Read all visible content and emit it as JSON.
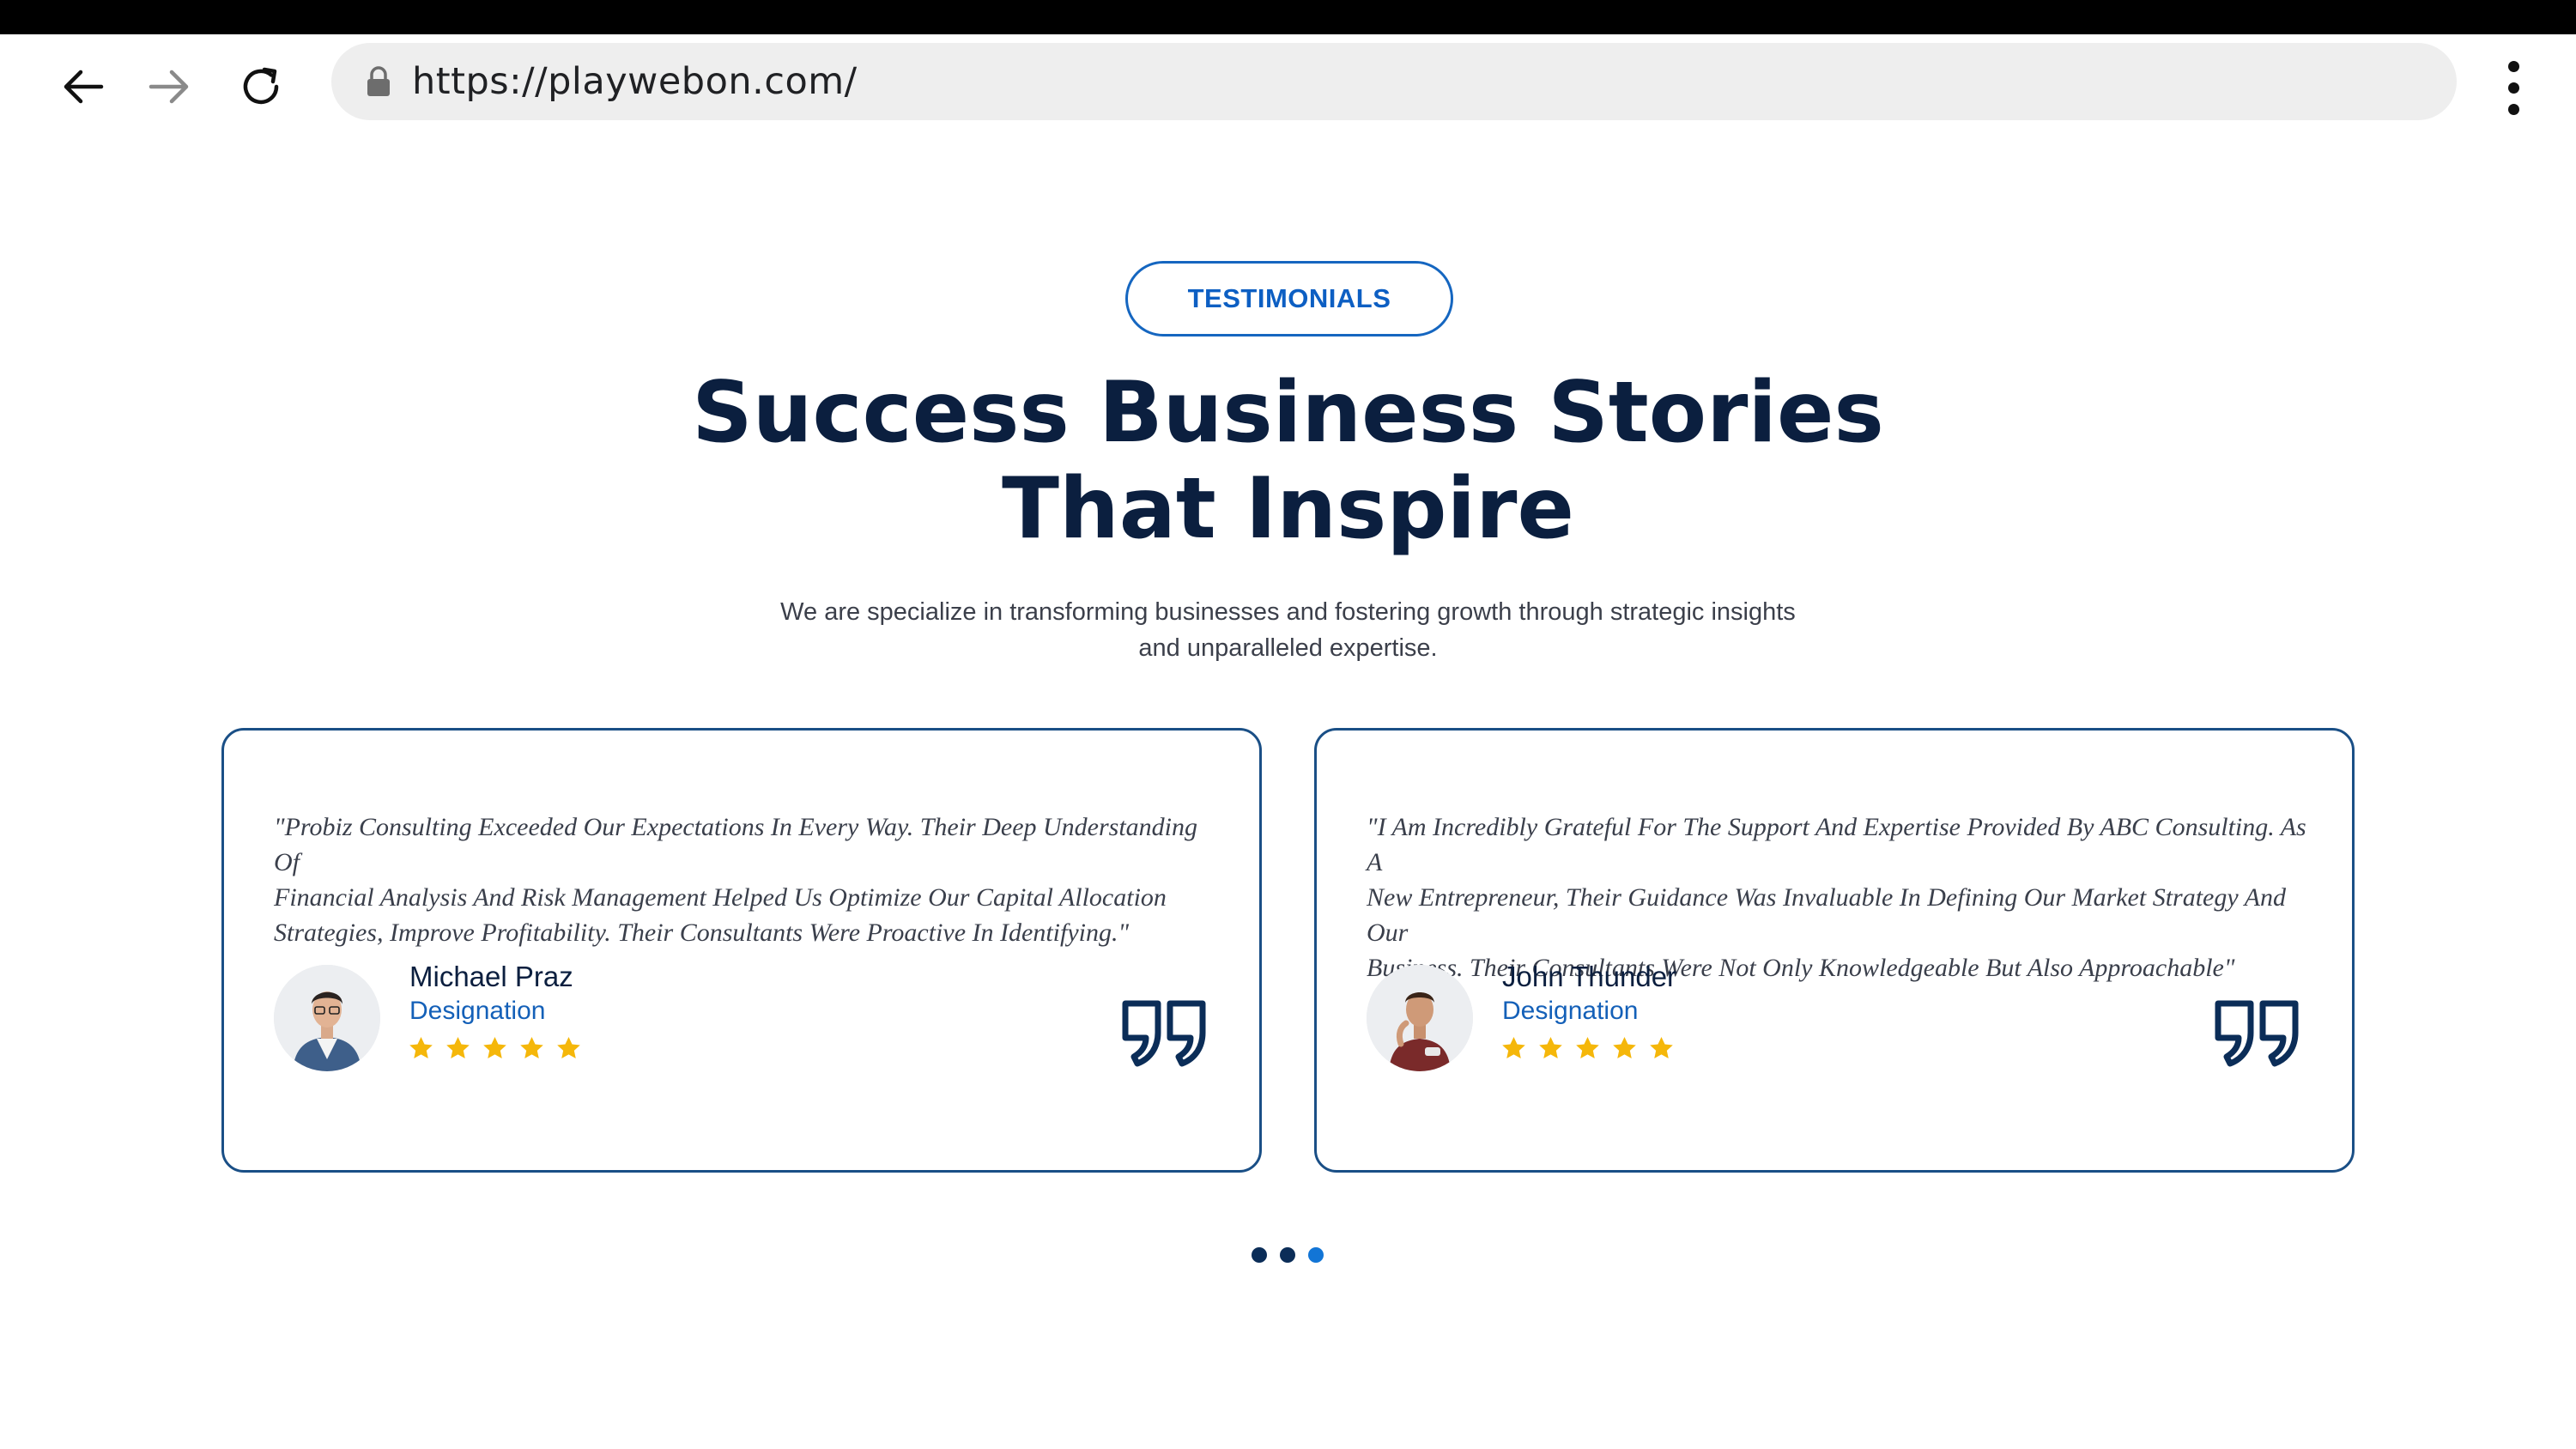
{
  "browser": {
    "url": "https://playwebon.com/",
    "icons": [
      "back-arrow-icon",
      "forward-arrow-icon",
      "reload-icon",
      "lock-icon",
      "more-vert-icon"
    ]
  },
  "section": {
    "badge": "TESTIMONIALS",
    "title_line1": "Success Business Stories",
    "title_line2": "That Inspire",
    "subtitle_line1": "We are specialize in transforming businesses and fostering growth through strategic insights",
    "subtitle_line2": "and unparalleled expertise."
  },
  "testimonials": [
    {
      "quote_line1": "\"Probiz Consulting Exceeded Our Expectations In Every Way. Their Deep Understanding Of",
      "quote_line2": "Financial Analysis And Risk Management Helped Us Optimize Our Capital Allocation",
      "quote_line3": "Strategies, Improve Profitability. Their Consultants Were Proactive In Identifying.\"",
      "name": "Michael Praz",
      "designation": "Designation",
      "rating": 5
    },
    {
      "quote_line1": "\"I Am Incredibly Grateful For The Support And Expertise Provided By ABC Consulting. As A",
      "quote_line2": "New Entrepreneur, Their Guidance Was Invaluable In Defining Our Market Strategy And Our",
      "quote_line3": "Business. Their Consultants Were Not Only Knowledgeable But Also Approachable\"",
      "name": "John Thunder",
      "designation": "Designation",
      "rating": 5
    }
  ],
  "carousel": {
    "total_pages": 3,
    "active_page": 3
  },
  "colors": {
    "accent": "#1566c0",
    "heading": "#0b1f3f",
    "star": "#f5b70a",
    "card_border": "#1a4f86"
  }
}
